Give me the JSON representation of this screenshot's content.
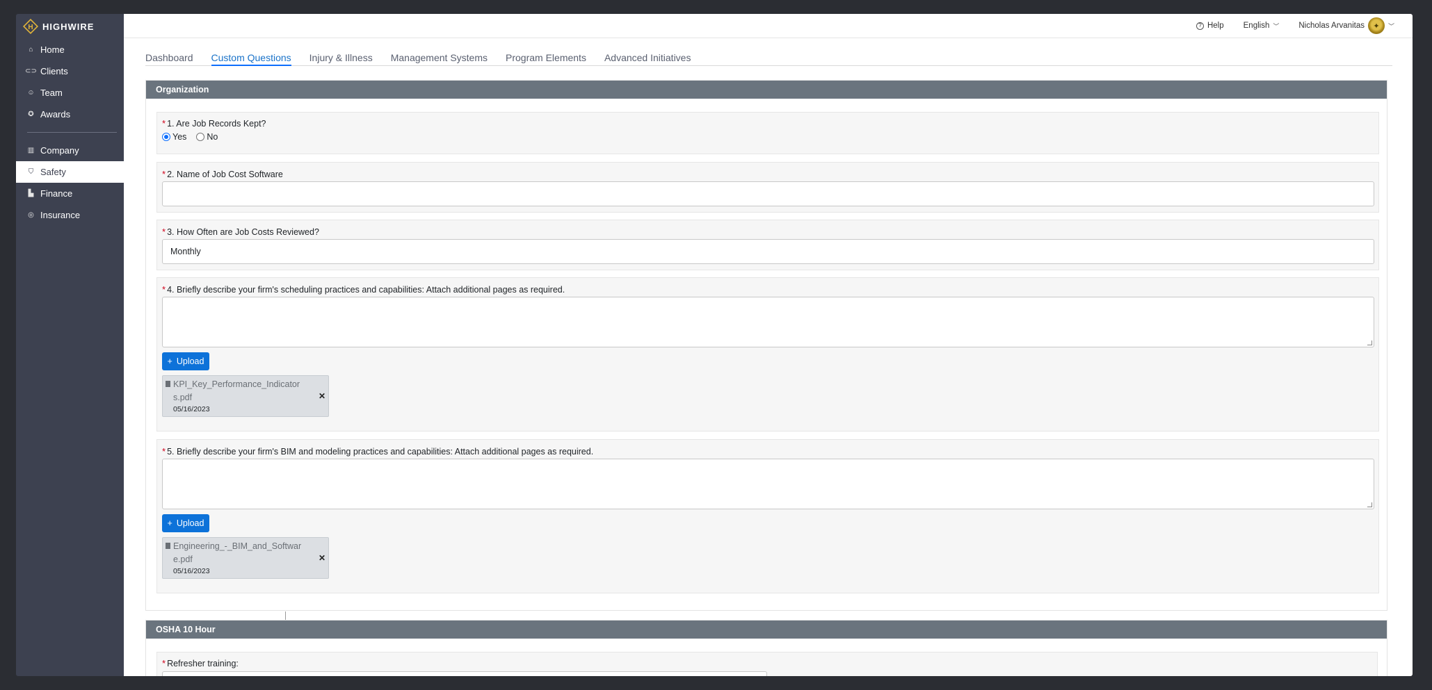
{
  "brand": {
    "name": "HIGHWIRE",
    "accent": "#e3b53a"
  },
  "sidebar": {
    "items": [
      {
        "label": "Home",
        "icon": "home-icon"
      },
      {
        "label": "Clients",
        "icon": "handshake-icon"
      },
      {
        "label": "Team",
        "icon": "users-icon"
      },
      {
        "label": "Awards",
        "icon": "award-icon"
      }
    ],
    "items2": [
      {
        "label": "Company",
        "icon": "building-icon"
      },
      {
        "label": "Safety",
        "icon": "shield-icon",
        "active": true
      },
      {
        "label": "Finance",
        "icon": "chart-icon"
      },
      {
        "label": "Insurance",
        "icon": "lifebuoy-icon"
      }
    ]
  },
  "topbar": {
    "help": "Help",
    "language": "English",
    "user": "Nicholas Arvanitas"
  },
  "tabs": [
    "Dashboard",
    "Custom Questions",
    "Injury & Illness",
    "Management Systems",
    "Program Elements",
    "Advanced Initiatives"
  ],
  "active_tab": "Custom Questions",
  "sections": {
    "organization": {
      "title": "Organization",
      "q1": {
        "label": "1. Are Job Records Kept?",
        "yes": "Yes",
        "no": "No",
        "selected": "Yes"
      },
      "q2": {
        "label": "2. Name of Job Cost Software",
        "value": ""
      },
      "q3": {
        "label": "3. How Often are Job Costs Reviewed?",
        "value": "Monthly"
      },
      "q4": {
        "label": "4. Briefly describe your firm's scheduling practices and capabilities: Attach additional pages as required.",
        "upload": "Upload",
        "file": {
          "name": "KPI_Key_Performance_Indicators.pdf",
          "date": "05/16/2023"
        }
      },
      "q5": {
        "label": "5. Briefly describe your firm's BIM and modeling practices and capabilities: Attach additional pages as required.",
        "upload": "Upload",
        "file": {
          "name": "Engineering_-_BIM_and_Software.pdf",
          "date": "05/16/2023"
        }
      }
    },
    "osha": {
      "title": "OSHA 10 Hour",
      "q1": {
        "label": "Refresher training:"
      }
    }
  },
  "required_marker": "*"
}
